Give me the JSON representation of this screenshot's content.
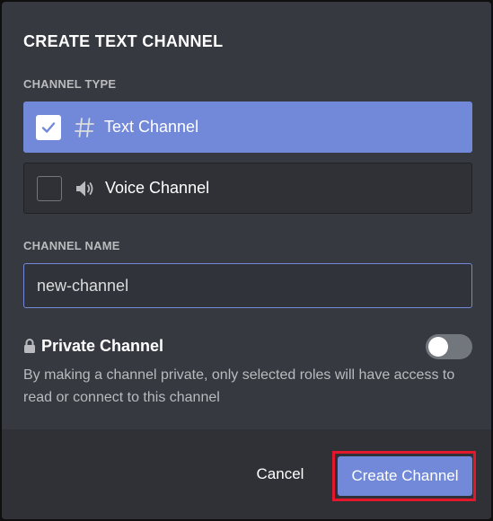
{
  "modal": {
    "title": "CREATE TEXT CHANNEL",
    "channel_type_label": "CHANNEL TYPE",
    "types": [
      {
        "label": "Text Channel",
        "icon": "hash-icon",
        "selected": true
      },
      {
        "label": "Voice Channel",
        "icon": "speaker-icon",
        "selected": false
      }
    ],
    "channel_name_label": "CHANNEL NAME",
    "channel_name_value": "new-channel",
    "private": {
      "icon": "lock-icon",
      "label": "Private Channel",
      "enabled": false,
      "help": "By making a channel private, only selected roles will have access to read or connect to this channel"
    }
  },
  "footer": {
    "cancel_label": "Cancel",
    "create_label": "Create Channel"
  },
  "colors": {
    "accent": "#7289da",
    "background": "#36393f",
    "footer_bg": "#2f3136",
    "highlight": "#e3182d"
  }
}
